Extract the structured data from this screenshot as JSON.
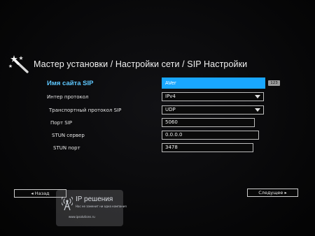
{
  "header": {
    "title": "Мастер установки / Настройки сети / SIP Настройки"
  },
  "form": {
    "rows": [
      {
        "label": "Имя сайта SIP",
        "value": "AVer",
        "badge": "123"
      },
      {
        "label": "Интер протокол",
        "value": "IPv4"
      },
      {
        "label": "Транспортный протокол SIP",
        "value": "UDP"
      },
      {
        "label": "Порт SIP",
        "value": "5060"
      },
      {
        "label": "STUN сервер",
        "value": "0.0.0.0"
      },
      {
        "label": "STUN порт",
        "value": "3478"
      }
    ]
  },
  "nav": {
    "back_label": "◂ Назад",
    "next_label": "Следущее ▸"
  },
  "watermark": {
    "name": "IP решения",
    "tagline": "Нас не заменит ни одна компания",
    "url": "www.ipsolutions.ru"
  },
  "colors": {
    "accent": "#19a7ff",
    "active_label": "#5ec8ff",
    "background": "#050506"
  }
}
